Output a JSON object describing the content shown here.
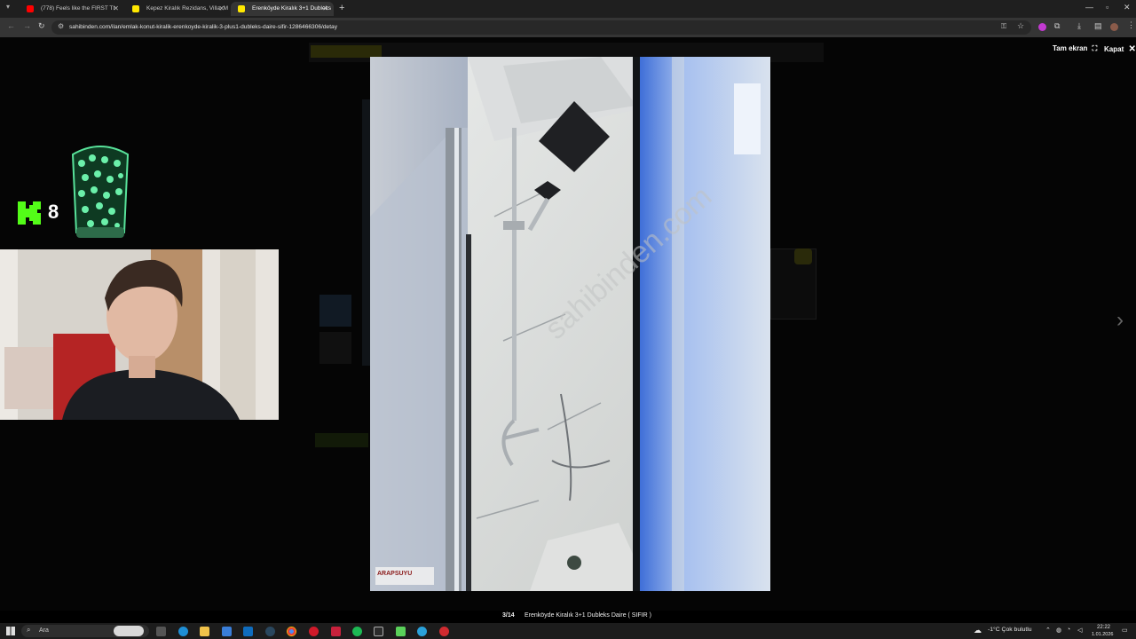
{
  "browser": {
    "tabs": [
      {
        "title": "(778) Feels like the FIRST TI",
        "favicon_color": "#ff0000"
      },
      {
        "title": "Kepez Kiralık Rezidans, Villa, M",
        "favicon_color": "#ffe800"
      },
      {
        "title": "Erenköyde Kiralık 3+1 Dubleks",
        "favicon_color": "#ffe800"
      }
    ],
    "new_tab": "+",
    "url": "sahibinden.com/ilan/emlak-konut-kiralik-erenkoyde-kiralik-3-plus1-dubleks-daire-sifir-1286466306/detay"
  },
  "lightbox": {
    "fullscreen_label": "Tam ekran",
    "close_label": "Kapat",
    "counter": "3/14",
    "caption": "Erenköyde Kiralık 3+1 Dubleks Daire ( SIFIR )",
    "watermark": "sahibinden.com",
    "photo_badge": "ARAPSUYU",
    "next_icon": "chevron-right-icon"
  },
  "stream_overlay": {
    "count": "8",
    "logo": "kick-logo"
  },
  "taskbar": {
    "search_placeholder": "Ara",
    "weather": "-1°C  Çok bulutlu",
    "time": "22:22",
    "date": "1.01.2026"
  }
}
